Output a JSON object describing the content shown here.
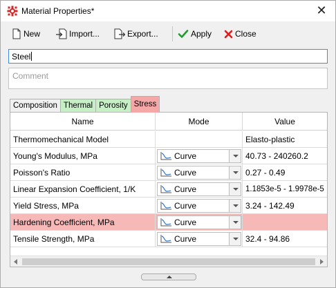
{
  "window": {
    "title": "Material Properties*",
    "close_symbol": "✕"
  },
  "toolbar": {
    "new_label": "New",
    "import_label": "Import...",
    "export_label": "Export...",
    "apply_label": "Apply",
    "close_label": "Close"
  },
  "name_field": {
    "value": "Steel"
  },
  "comment_field": {
    "placeholder": "Comment"
  },
  "tabs": [
    {
      "label": "Composition"
    },
    {
      "label": "Thermal"
    },
    {
      "label": "Porosity"
    },
    {
      "label": "Stress",
      "selected": true
    }
  ],
  "table": {
    "columns": [
      "Name",
      "Mode",
      "Value"
    ],
    "rows": [
      {
        "name": "Thermomechanical Model",
        "mode": "",
        "value": "Elasto-plastic"
      },
      {
        "name": "Young's Modulus, MPa",
        "mode": "Curve",
        "value": "40.73 - 240260.2"
      },
      {
        "name": "Poisson's Ratio",
        "mode": "Curve",
        "value": "0.27 - 0.49"
      },
      {
        "name": "Linear Expansion Coefficient, 1/K",
        "mode": "Curve",
        "value": "1.1853e-5 - 1.9978e-5"
      },
      {
        "name": "Yield Stress, MPa",
        "mode": "Curve",
        "value": "3.24 - 142.49"
      },
      {
        "name": "Hardening Coefficient, MPa",
        "mode": "Curve",
        "value": "",
        "highlighted": true
      },
      {
        "name": "Tensile Strength, MPa",
        "mode": "Curve",
        "value": "32.4 - 94.86"
      }
    ]
  },
  "colors": {
    "thermal_tab": "#c6efc6",
    "porosity_tab": "#c6efc6",
    "stress_tab": "#f5a8a8",
    "highlight_row": "#f7b8b8",
    "input_focus_border": "#3d8ee0",
    "app_icon": "#d22a2a",
    "apply_check": "#1e9c2e",
    "close_x": "#d81e1e"
  }
}
